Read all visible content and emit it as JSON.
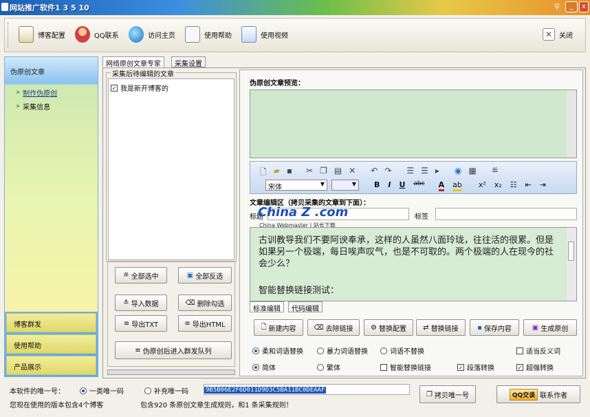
{
  "window": {
    "title": "网站推广软件1 3 5 10"
  },
  "toolbar": {
    "items": [
      "博客配置",
      "QQ联系",
      "访问主页",
      "使用帮助",
      "使用视频"
    ],
    "close": "关闭"
  },
  "sidebar": {
    "header": "伪原创文章",
    "items": [
      "制作伪原创",
      "采集信息"
    ],
    "bottom": [
      "博客群发",
      "使用帮助",
      "产品展示"
    ]
  },
  "tabs": [
    "网络原创文章专家",
    "采集设置"
  ],
  "collect": {
    "group_title": "采集后待编辑的文章",
    "items": [
      "我是新开博客的"
    ]
  },
  "left_buttons": {
    "select_all": "全部选中",
    "invert": "全部反选",
    "import": "导入数据",
    "delete": "删除勾选",
    "export_txt": "导出TXT",
    "export_html": "导出HTML",
    "queue": "伪原创后进入群发队列"
  },
  "preview": {
    "label": "伪原创文章预览："
  },
  "editor": {
    "font": "宋体",
    "edit_label": "文章编辑区（拷贝采集的文章到下面）：",
    "title_label": "标题",
    "tag_label": "标签",
    "content_line1": "古训教导我们不要阿谀奉承，这样的人虽然八面玲珑，往往活的很累。但是如果另一个极端，每日唉声叹气，也是不可取的。两个极端的人在现今的社会少么？",
    "content_line2": "智能替换链接测试：",
    "tab_standard": "标准编辑",
    "tab_code": "代码编辑"
  },
  "watermark": {
    "brand": "China Z .com",
    "sub": "China Webmaster | 站长下载"
  },
  "actions": {
    "new": "新建内容",
    "remove_links": "去除链接",
    "replace_cfg": "替换配置",
    "replace_links": "替换链接",
    "save": "保存内容",
    "generate": "生成原创"
  },
  "options": {
    "soft": "柔和词语替换",
    "violent": "暴力词语替换",
    "none": "词语不替换",
    "antonym": "适当反义词",
    "simplified": "简体",
    "traditional": "繁体",
    "smart_link": "智能替换链接",
    "para": "段落转换",
    "super": "超强转换"
  },
  "footer": {
    "id_label": "本软件的唯一号：",
    "radio1": "一类唯一码",
    "radio2": "补充唯一码",
    "code": "9B5B06E2F6D011D9D3C5BA11BC0DEAAF",
    "version_text": "您现在使用的版本包含4个博客",
    "rules_text": "包含920 条原创文章生成规则，和1 条采集规则！",
    "copy_btn": "拷贝唯一号",
    "qq_btn": "QQ交谈",
    "contact": "联系作者"
  },
  "colors": {
    "preview_bg": "#cfe8cf",
    "editor_bg": "#d6ecd4",
    "sidebar": "#5aa9e6",
    "code_bg": "#1e56b6"
  }
}
